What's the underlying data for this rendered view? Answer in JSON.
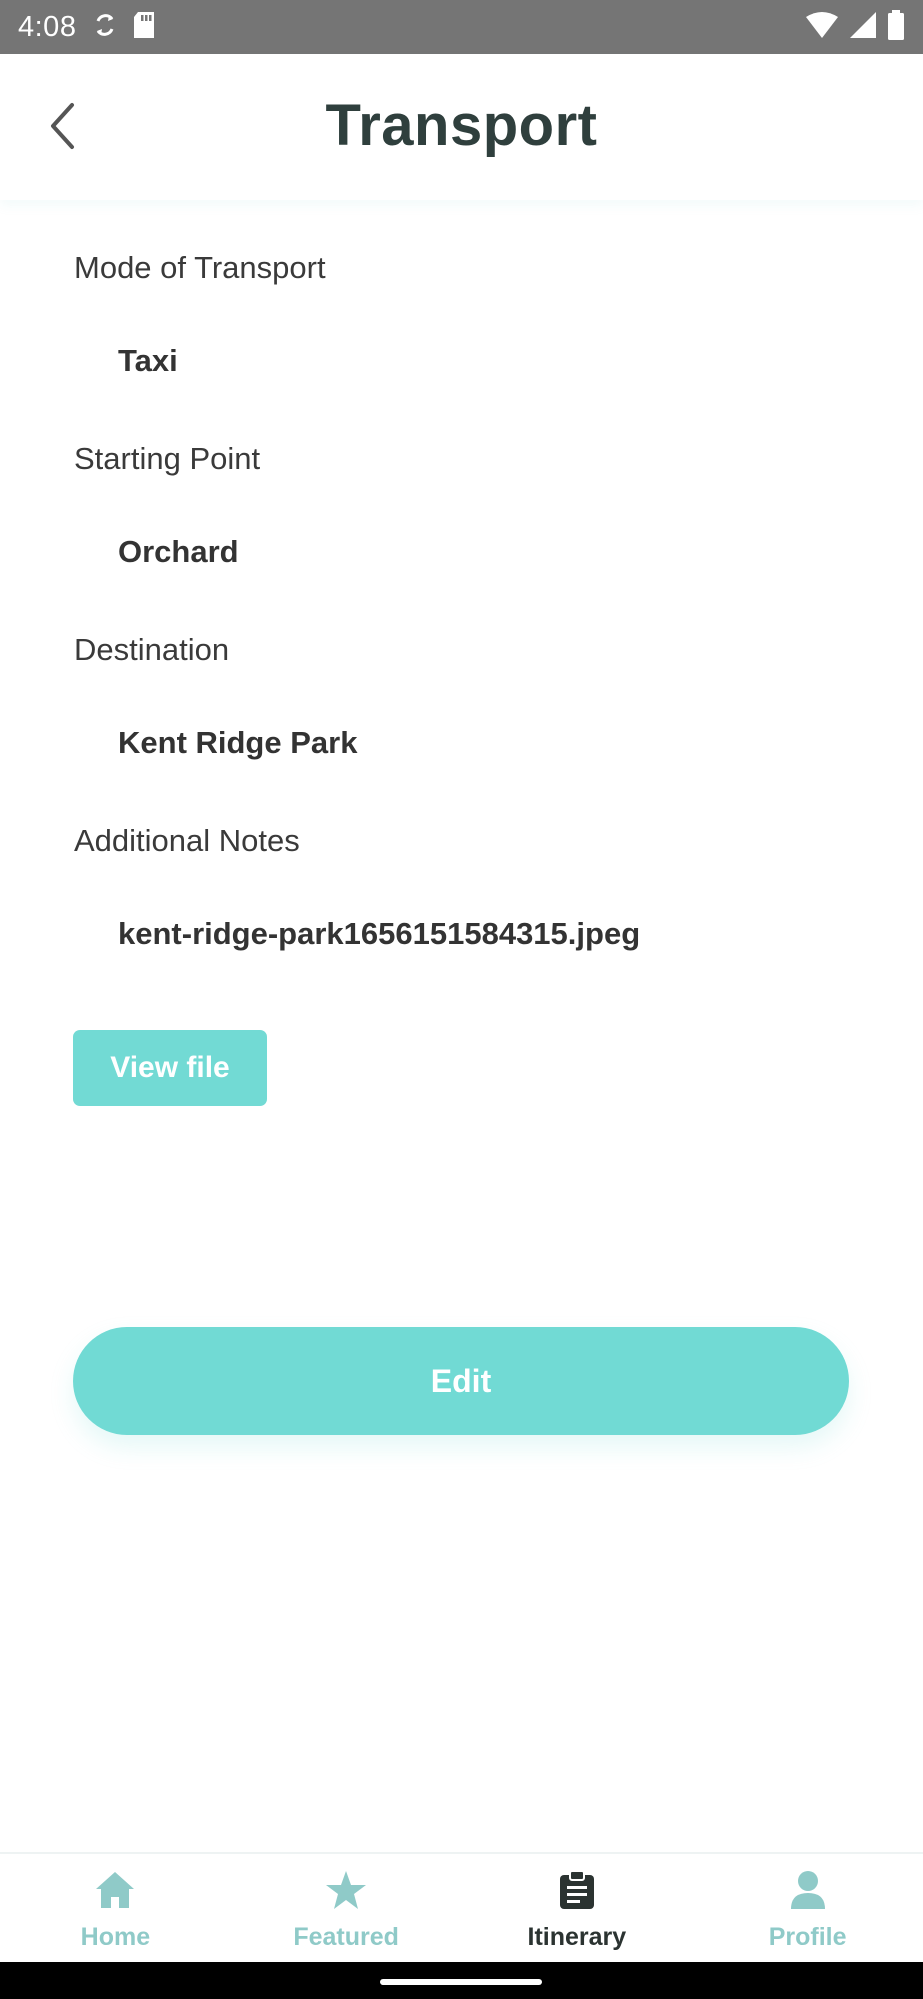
{
  "status_bar": {
    "time": "4:08"
  },
  "header": {
    "title": "Transport"
  },
  "fields": [
    {
      "label": "Mode of Transport",
      "value": "Taxi"
    },
    {
      "label": "Starting Point",
      "value": "Orchard"
    },
    {
      "label": "Destination",
      "value": "Kent Ridge Park"
    },
    {
      "label": "Additional Notes",
      "value": "kent-ridge-park1656151584315.jpeg"
    }
  ],
  "buttons": {
    "view_file": "View file",
    "edit": "Edit"
  },
  "nav": [
    {
      "label": "Home",
      "icon": "home-icon",
      "active": false
    },
    {
      "label": "Featured",
      "icon": "star-icon",
      "active": false
    },
    {
      "label": "Itinerary",
      "icon": "clipboard-icon",
      "active": true
    },
    {
      "label": "Profile",
      "icon": "user-icon",
      "active": false
    }
  ],
  "colors": {
    "accent": "#71dad4",
    "title": "#2f3f3d",
    "nav_inactive": "#8fcac8",
    "nav_active": "#2b3331",
    "status_bar": "#757575"
  }
}
